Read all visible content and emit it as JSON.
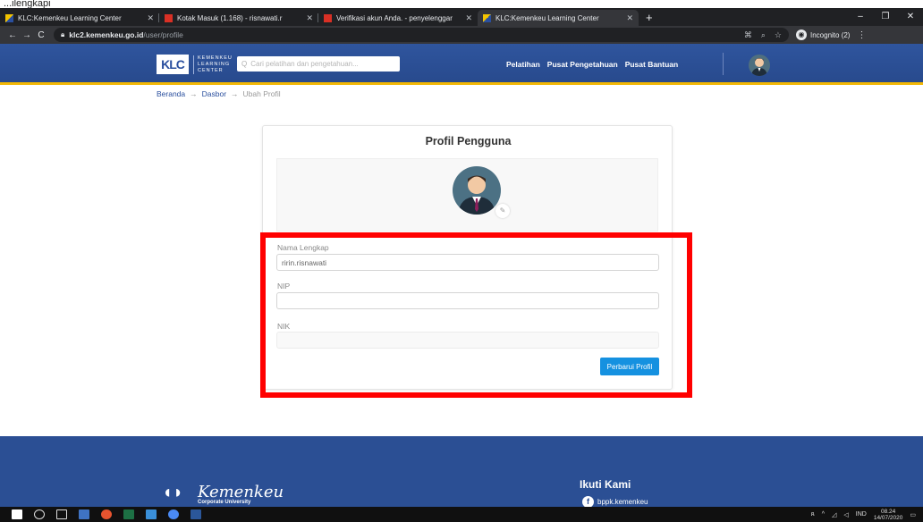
{
  "caption": "...ilengkapi",
  "browser": {
    "tabs": [
      {
        "title": "KLC:Kemenkeu Learning Center",
        "icon": "klc-favicon"
      },
      {
        "title": "Kotak Masuk (1.168) - risnawati.r",
        "icon": "gmail-favicon"
      },
      {
        "title": "Verifikasi akun Anda. - penyelenggar",
        "icon": "gmail-favicon"
      },
      {
        "title": "KLC:Kemenkeu Learning Center",
        "icon": "klc-favicon",
        "active": true
      }
    ],
    "new_tab": "+",
    "window_controls": [
      "–",
      "❐",
      "✕"
    ],
    "url_host": "klc2.kemenkeu.go.id",
    "url_path": "/user/profile",
    "incognito_label": "Incognito (2)"
  },
  "site": {
    "logo_mark": "KLC",
    "logo_words": [
      "KEMENKEU",
      "LEARNING",
      "CENTER"
    ],
    "search_placeholder": "Cari pelatihan dan pengetahuan...",
    "nav": [
      "Pelatihan",
      "Pusat Pengetahuan",
      "Pusat Bantuan"
    ]
  },
  "breadcrumb": [
    "Beranda",
    "Dasbor",
    "Ubah Profil"
  ],
  "profile": {
    "title": "Profil Pengguna",
    "fields": {
      "nama_label": "Nama Lengkap",
      "nama_value": "ririn.risnawati",
      "nip_label": "NIP",
      "nip_value": "",
      "nik_label": "NIK",
      "nik_value": ""
    },
    "submit_label": "Perbarui Profil"
  },
  "footer": {
    "brand": "Kemenkeu",
    "brand_sub": "Corporate University",
    "follow_title": "Ikuti Kami",
    "social_handle": "bppk.kemenkeu"
  },
  "taskbar": {
    "lang": "IND",
    "time": "08.24",
    "date": "14/07/2020"
  },
  "colors": {
    "header_blue": "#2a4f9e",
    "accent_yellow": "#f2b705",
    "button_blue": "#1591e0",
    "annotation_red": "#ff0000"
  }
}
